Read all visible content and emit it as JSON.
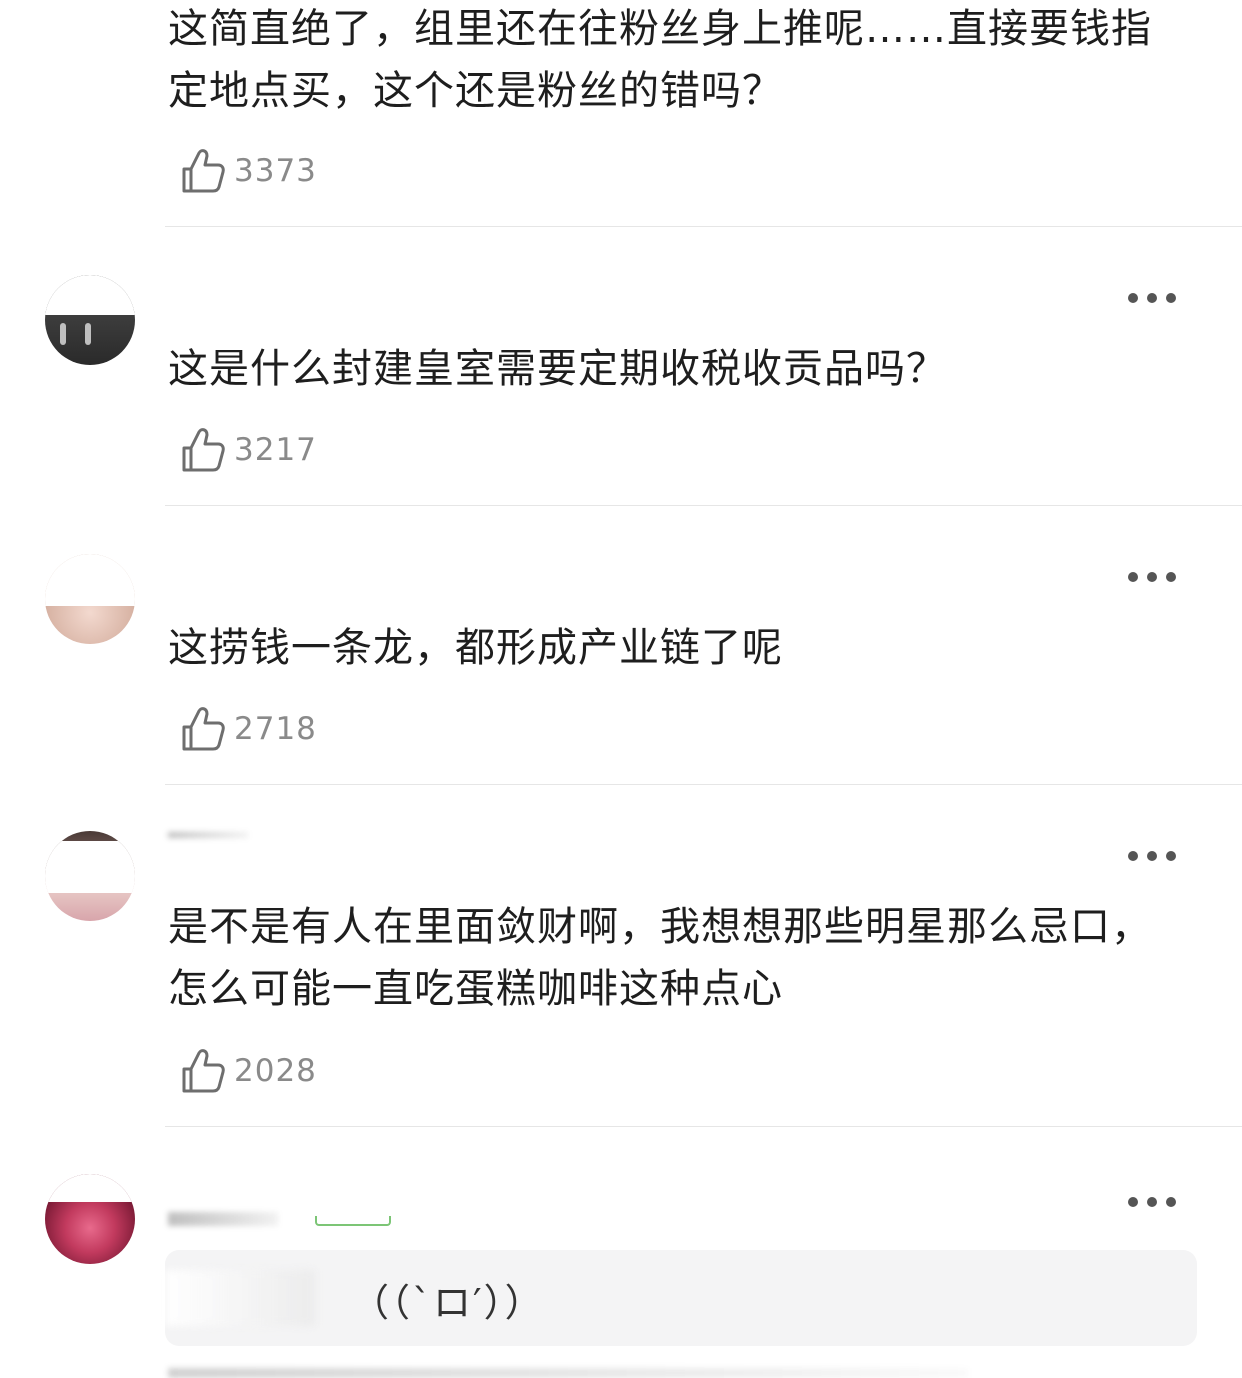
{
  "comments": [
    {
      "text": "这简直绝了，组里还在往粉丝身上推呢……直接要钱指定地点买，这个还是粉丝的错吗？",
      "likes": "3373"
    },
    {
      "text": "这是什么封建皇室需要定期收税收贡品吗？",
      "likes": "3217"
    },
    {
      "text": "这捞钱一条龙，都形成产业链了呢",
      "likes": "2718"
    },
    {
      "text": "是不是有人在里面敛财啊，我想想那些明星那么忌口，怎么可能一直吃蛋糕咖啡这种点心",
      "likes": "2028"
    }
  ],
  "reply_preview": {
    "text": "（（`ロ′））"
  },
  "icons": {
    "like": "thumbs-up-icon",
    "more": "more-options-icon"
  },
  "colors": {
    "text": "#1e1e1e",
    "meta": "#8a8a8a",
    "divider": "#e6e6e6",
    "reply_bg": "#f4f4f5",
    "badge": "#7cc576"
  }
}
